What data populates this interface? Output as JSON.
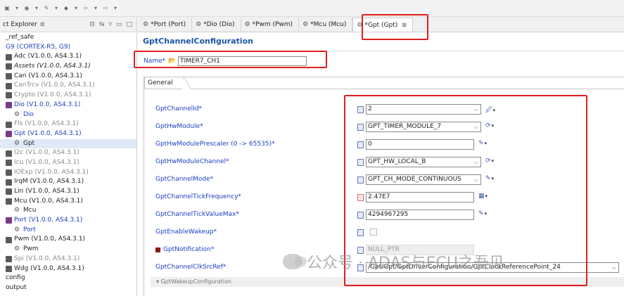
{
  "toolbar": {
    "icons": [
      "toolbar-icon",
      "dropdown-icon",
      "toolbar-icon",
      "dropdown-icon",
      "toolbar-icon",
      "dropdown-icon",
      "toolbar-icon",
      "dropdown-icon",
      "toolbar-icon",
      "dropdown-icon",
      "toolbar-icon",
      "dropdown-icon"
    ]
  },
  "explorer": {
    "title": "ct Explorer",
    "tree": [
      {
        "label": "_ref_safe",
        "kind": "text"
      },
      {
        "label": "G9 (CORTEX-R5, G9)",
        "kind": "blue"
      },
      {
        "label": "Adc (V1.0.0, AS4.3.1)",
        "kind": "module"
      },
      {
        "label": "Assets (V1.0.0, AS4.3.1)",
        "kind": "module-italic"
      },
      {
        "label": "Can (V1.0.0, AS4.3.1)",
        "kind": "module"
      },
      {
        "label": "CanTrcv (V1.0.0, AS4.3.1)",
        "kind": "gray"
      },
      {
        "label": "Crypto (V1.0.0, AS4.3.1)",
        "kind": "gray"
      },
      {
        "label": "Dio (V1.0.0, AS4.3.1)",
        "kind": "blue"
      },
      {
        "label": "Dio",
        "kind": "cfg-blue"
      },
      {
        "label": "Fls (V1.0.0, AS4.3.1)",
        "kind": "gray"
      },
      {
        "label": "Gpt (V1.0.0, AS4.3.1)",
        "kind": "blue"
      },
      {
        "label": "Gpt",
        "kind": "cfg-sel"
      },
      {
        "label": "I2c (V1.0.0, AS4.3.1)",
        "kind": "gray"
      },
      {
        "label": "Icu (V1.0.0, AS4.3.1)",
        "kind": "gray"
      },
      {
        "label": "IOExp (V1.0.0, AS4.3.1)",
        "kind": "gray"
      },
      {
        "label": "IrqM (V1.0.0, AS4.3.1)",
        "kind": "module"
      },
      {
        "label": "Lin (V1.0.0, AS4.3.1)",
        "kind": "module"
      },
      {
        "label": "Mcu (V1.0.0, AS4.3.1)",
        "kind": "module"
      },
      {
        "label": "Mcu",
        "kind": "cfg"
      },
      {
        "label": "Port (V1.0.0, AS4.3.1)",
        "kind": "blue"
      },
      {
        "label": "Port",
        "kind": "cfg-blue"
      },
      {
        "label": "Pwm (V1.0.0, AS4.3.1)",
        "kind": "module"
      },
      {
        "label": "Pwm",
        "kind": "cfg"
      },
      {
        "label": "Spi (V1.0.0, AS4.3.1)",
        "kind": "gray"
      },
      {
        "label": "Wdg (V1.0.0, AS4.3.1)",
        "kind": "module"
      },
      {
        "label": "config",
        "kind": "text"
      },
      {
        "label": "output",
        "kind": "text"
      }
    ]
  },
  "tabs": [
    {
      "label": "*Port (Port)",
      "active": false
    },
    {
      "label": "*Dio (Dio)",
      "active": false
    },
    {
      "label": "*Pwm (Pwm)",
      "active": false
    },
    {
      "label": "*Mcu (Mcu)",
      "active": false
    },
    {
      "label": "*Gpt (Gpt)",
      "active": true
    }
  ],
  "editor": {
    "title": "GptChannelConfiguration",
    "name_label": "Name*",
    "name_value": "TIMER7_CH1",
    "general_tab": "General",
    "wakeup_section": "GptWakeupConfiguration"
  },
  "params": [
    {
      "label": "GptChannelId*",
      "value": "2",
      "type": "combo"
    },
    {
      "label": "GptHwModule*",
      "value": "GPT_TIMER_MODULE_7",
      "type": "combo"
    },
    {
      "label": "GptHwModulePrescaler (0 -> 65535)*",
      "value": "0",
      "type": "text"
    },
    {
      "label": "GptHwModuleChannel*",
      "value": "GPT_HW_LOCAL_B",
      "type": "combo"
    },
    {
      "label": "GptChannelMode*",
      "value": "GPT_CH_MODE_CONTINUOUS",
      "type": "combo"
    },
    {
      "label": "GptChannelTickFrequency*",
      "value": "2.47E7",
      "type": "text"
    },
    {
      "label": "GptChannelTickValueMax*",
      "value": "4294967295",
      "type": "text"
    },
    {
      "label": "GptEnableWakeup*",
      "value": "",
      "type": "checkbox"
    },
    {
      "label": "GptNotification*",
      "value": "NULL_PTR",
      "type": "disabled"
    },
    {
      "label": "GptChannelClkSrcRef*",
      "value": "/Gpt/Gpt/GptDriverConfiguration/GptClockReferencePoint_24",
      "type": "ref"
    }
  ],
  "watermark": {
    "text": "公众号 · ADAS与ECU之吾见"
  },
  "colors": {
    "highlight": "#e01f1f",
    "title_blue": "#1c56a5",
    "label_blue": "#1a3fbf"
  }
}
